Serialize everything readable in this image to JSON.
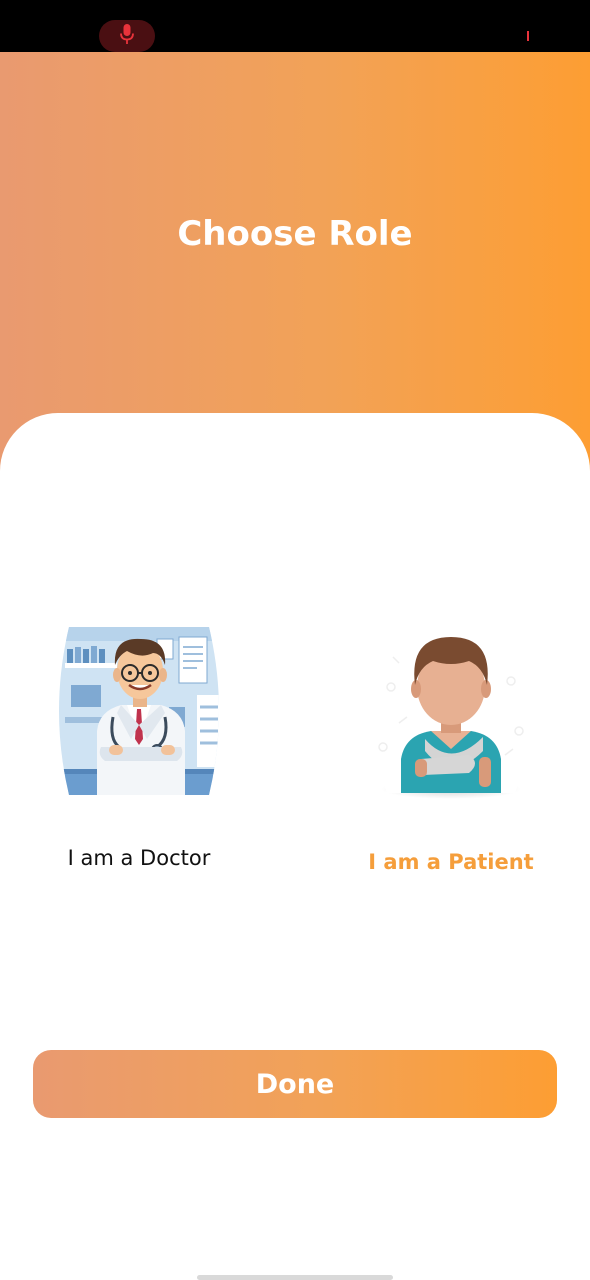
{
  "header": {
    "title": "Choose Role"
  },
  "roles": [
    {
      "label": "I am a Doctor",
      "selected": false,
      "icon": "doctor-illustration"
    },
    {
      "label": "I am a Patient",
      "selected": true,
      "icon": "patient-illustration"
    }
  ],
  "actions": {
    "done_label": "Done"
  },
  "status_bar": {
    "icons": [
      "microphone-icon"
    ]
  },
  "colors": {
    "accent": "#f59e3b",
    "gradient_start": "#e99a70",
    "gradient_end": "#fd9e33",
    "status_bar": "#000000"
  }
}
